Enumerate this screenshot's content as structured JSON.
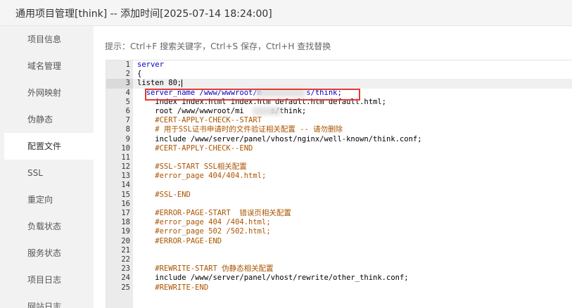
{
  "window": {
    "title": "通用项目管理[think] -- 添加时间[2025-07-14 18:24:00]"
  },
  "sidebar": {
    "items": [
      {
        "label": "项目信息",
        "name": "sidebar-item-project-info"
      },
      {
        "label": "域名管理",
        "name": "sidebar-item-domains"
      },
      {
        "label": "外网映射",
        "name": "sidebar-item-port-mapping"
      },
      {
        "label": "伪静态",
        "name": "sidebar-item-rewrite"
      },
      {
        "label": "配置文件",
        "name": "sidebar-item-config-file",
        "active": true
      },
      {
        "label": "SSL",
        "name": "sidebar-item-ssl"
      },
      {
        "label": "重定向",
        "name": "sidebar-item-redirect"
      },
      {
        "label": "负载状态",
        "name": "sidebar-item-load-status"
      },
      {
        "label": "服务状态",
        "name": "sidebar-item-service-status"
      },
      {
        "label": "项目日志",
        "name": "sidebar-item-project-log"
      },
      {
        "label": "网站日志",
        "name": "sidebar-item-site-log"
      }
    ]
  },
  "hint": "提示：Ctrl+F 搜索关键字，Ctrl+S 保存，Ctrl+H 查找替换",
  "editor": {
    "active_line": 3,
    "lines": [
      {
        "n": "1",
        "text": "server",
        "cls": "kw"
      },
      {
        "n": "2",
        "text": "{",
        "cls": ""
      },
      {
        "n": "3",
        "text": "listen 80;",
        "cls": ""
      },
      {
        "n": "4",
        "text": "  server_name /www/wwwroot/m          s/think;",
        "cls": "kw"
      },
      {
        "n": "5",
        "text": "    index index.html index.htm default.htm default.html;",
        "cls": ""
      },
      {
        "n": "6",
        "text": "    root /www/wwwroot/mi      s/think;",
        "cls": ""
      },
      {
        "n": "7",
        "text": "    #CERT-APPLY-CHECK--START",
        "cls": "cmt"
      },
      {
        "n": "8",
        "text": "    # 用于SSL证书申请时的文件验证相关配置 -- 请勿删除",
        "cls": "cmt"
      },
      {
        "n": "9",
        "text": "    include /www/server/panel/vhost/nginx/well-known/think.conf;",
        "cls": ""
      },
      {
        "n": "10",
        "text": "    #CERT-APPLY-CHECK--END",
        "cls": "cmt"
      },
      {
        "n": "11",
        "text": "",
        "cls": ""
      },
      {
        "n": "12",
        "text": "    #SSL-START SSL相关配置",
        "cls": "cmt"
      },
      {
        "n": "13",
        "text": "    #error_page 404/404.html;",
        "cls": "cmt"
      },
      {
        "n": "14",
        "text": "",
        "cls": ""
      },
      {
        "n": "15",
        "text": "    #SSL-END",
        "cls": "cmt"
      },
      {
        "n": "16",
        "text": "",
        "cls": ""
      },
      {
        "n": "17",
        "text": "    #ERROR-PAGE-START  错误页相关配置",
        "cls": "cmt"
      },
      {
        "n": "18",
        "text": "    #error_page 404 /404.html;",
        "cls": "cmt"
      },
      {
        "n": "19",
        "text": "    #error_page 502 /502.html;",
        "cls": "cmt"
      },
      {
        "n": "20",
        "text": "    #ERROR-PAGE-END",
        "cls": "cmt"
      },
      {
        "n": "21",
        "text": "",
        "cls": ""
      },
      {
        "n": "22",
        "text": "",
        "cls": ""
      },
      {
        "n": "23",
        "text": "    #REWRITE-START 伪静态相关配置",
        "cls": "cmt"
      },
      {
        "n": "24",
        "text": "    include /www/server/panel/vhost/rewrite/other_think.conf;",
        "cls": ""
      },
      {
        "n": "25",
        "text": "    #REWRITE-END",
        "cls": "cmt"
      }
    ]
  },
  "colors": {
    "keyword": "#0000cc",
    "comment": "#aa5500",
    "highlight_box": "#e53935"
  }
}
